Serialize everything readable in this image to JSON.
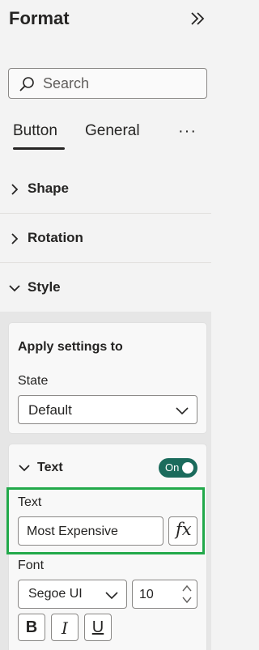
{
  "header": {
    "title": "Format"
  },
  "search": {
    "placeholder": "Search"
  },
  "tabs": [
    {
      "label": "Button",
      "active": true
    },
    {
      "label": "General",
      "active": false
    }
  ],
  "tabs_more": "···",
  "sections": [
    {
      "label": "Shape",
      "expanded": false
    },
    {
      "label": "Rotation",
      "expanded": false
    },
    {
      "label": "Style",
      "expanded": true
    }
  ],
  "apply_settings": {
    "title": "Apply settings to",
    "state_label": "State",
    "state_value": "Default"
  },
  "text_card": {
    "title": "Text",
    "toggle_label": "On",
    "text_label": "Text",
    "text_value": "Most Expensive",
    "fx_label": "fx",
    "font_label": "Font",
    "font_value": "Segoe UI",
    "size_value": "10",
    "bold": "B",
    "italic": "I",
    "underline": "U"
  },
  "colors": {
    "toggle_on": "#1b6b5c",
    "highlight": "#22a94a"
  }
}
